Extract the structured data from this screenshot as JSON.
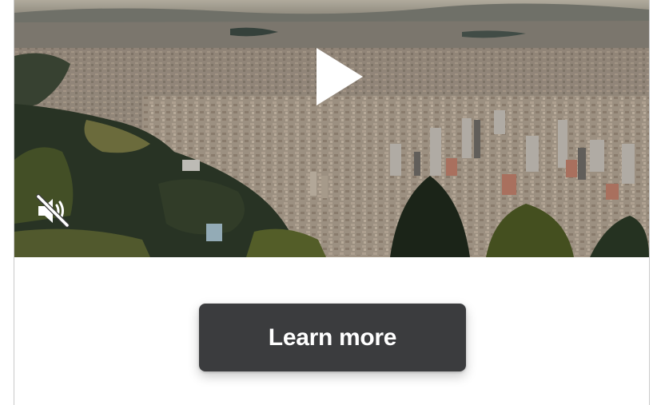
{
  "video": {
    "play_icon": "play-icon",
    "mute_icon": "speaker-muted-icon"
  },
  "cta": {
    "label": "Learn more"
  },
  "colors": {
    "button_bg": "#3b3c3e",
    "button_text": "#ffffff",
    "card_border": "#c9c9c9"
  }
}
